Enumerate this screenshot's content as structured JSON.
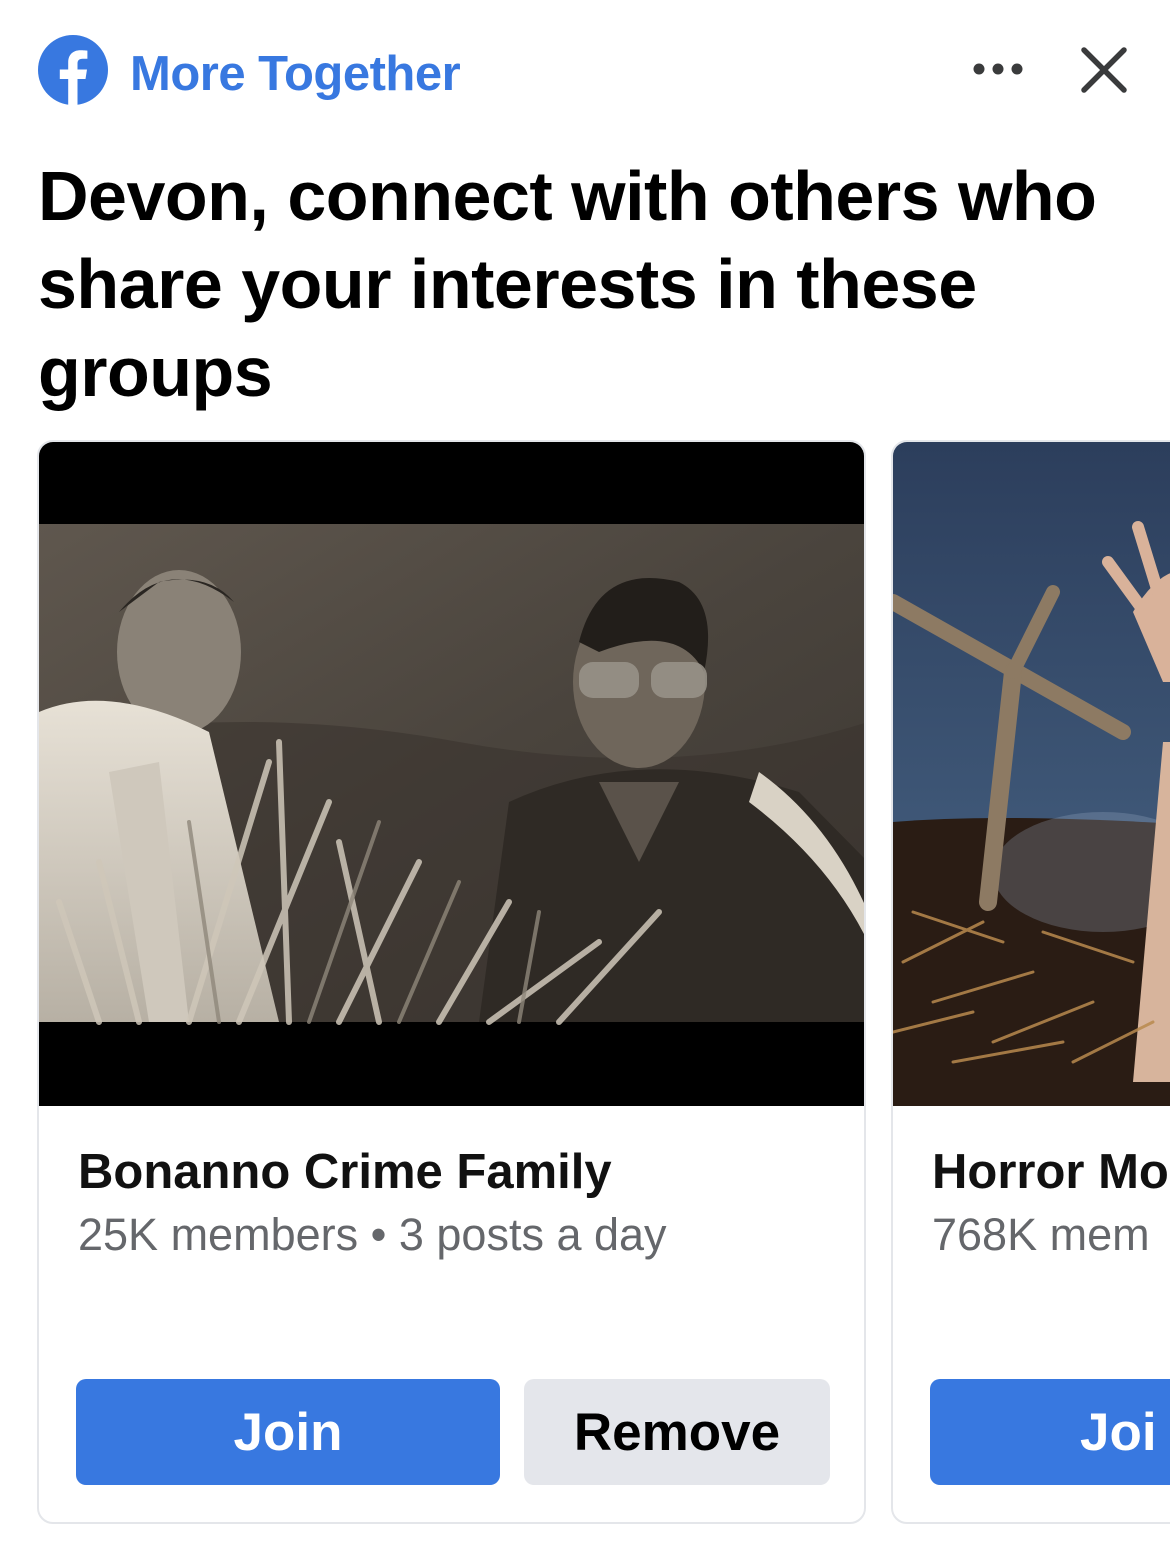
{
  "header": {
    "logo_icon": "facebook-logo-icon",
    "title": "More Together",
    "more_icon": "more-options-icon",
    "close_icon": "close-icon",
    "brand_color": "#3878e0"
  },
  "headline": "Devon, connect with others who share your interests in these groups",
  "groups": [
    {
      "name": "Bonanno Crime Family",
      "meta": "25K members • 3 posts a day",
      "join_label": "Join",
      "remove_label": "Remove"
    },
    {
      "name": "Horror Mo",
      "meta": "768K mem",
      "join_label": "Joi"
    }
  ],
  "colors": {
    "join_button": "#3878e0",
    "remove_button": "#e4e6eb",
    "secondary_text": "#65676b"
  }
}
